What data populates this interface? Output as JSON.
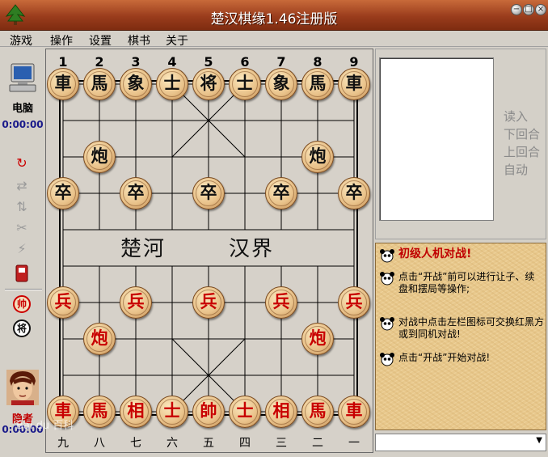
{
  "window": {
    "title": "楚汉棋缘1.46注册版"
  },
  "window_buttons": {
    "minimize": "−",
    "maximize": "□",
    "close": "×"
  },
  "menu": [
    {
      "label": "游戏"
    },
    {
      "label": "操作"
    },
    {
      "label": "设置"
    },
    {
      "label": "棋书"
    },
    {
      "label": "关于"
    }
  ],
  "top_player": {
    "name": "电脑",
    "time": "0:00:00"
  },
  "bottom_player": {
    "name": "隐者",
    "time": "0:00:00"
  },
  "tools": {
    "swap_side": "帅",
    "black_side": "将"
  },
  "board": {
    "col_numbers": [
      "1",
      "2",
      "3",
      "4",
      "5",
      "6",
      "7",
      "8",
      "9"
    ],
    "col_chinese": [
      "九",
      "八",
      "七",
      "六",
      "五",
      "四",
      "三",
      "二",
      "一"
    ],
    "river_left": "楚河",
    "river_right": "汉界",
    "pieces": [
      {
        "ch": "車",
        "side": "black",
        "col": 0,
        "row": 0
      },
      {
        "ch": "馬",
        "side": "black",
        "col": 1,
        "row": 0
      },
      {
        "ch": "象",
        "side": "black",
        "col": 2,
        "row": 0
      },
      {
        "ch": "士",
        "side": "black",
        "col": 3,
        "row": 0
      },
      {
        "ch": "将",
        "side": "black",
        "col": 4,
        "row": 0
      },
      {
        "ch": "士",
        "side": "black",
        "col": 5,
        "row": 0
      },
      {
        "ch": "象",
        "side": "black",
        "col": 6,
        "row": 0
      },
      {
        "ch": "馬",
        "side": "black",
        "col": 7,
        "row": 0
      },
      {
        "ch": "車",
        "side": "black",
        "col": 8,
        "row": 0
      },
      {
        "ch": "炮",
        "side": "black",
        "col": 1,
        "row": 2
      },
      {
        "ch": "炮",
        "side": "black",
        "col": 7,
        "row": 2
      },
      {
        "ch": "卒",
        "side": "black",
        "col": 0,
        "row": 3
      },
      {
        "ch": "卒",
        "side": "black",
        "col": 2,
        "row": 3
      },
      {
        "ch": "卒",
        "side": "black",
        "col": 4,
        "row": 3
      },
      {
        "ch": "卒",
        "side": "black",
        "col": 6,
        "row": 3
      },
      {
        "ch": "卒",
        "side": "black",
        "col": 8,
        "row": 3
      },
      {
        "ch": "兵",
        "side": "red",
        "col": 0,
        "row": 6
      },
      {
        "ch": "兵",
        "side": "red",
        "col": 2,
        "row": 6
      },
      {
        "ch": "兵",
        "side": "red",
        "col": 4,
        "row": 6
      },
      {
        "ch": "兵",
        "side": "red",
        "col": 6,
        "row": 6
      },
      {
        "ch": "兵",
        "side": "red",
        "col": 8,
        "row": 6
      },
      {
        "ch": "炮",
        "side": "red",
        "col": 1,
        "row": 7
      },
      {
        "ch": "炮",
        "side": "red",
        "col": 7,
        "row": 7
      },
      {
        "ch": "車",
        "side": "red",
        "col": 0,
        "row": 9
      },
      {
        "ch": "馬",
        "side": "red",
        "col": 1,
        "row": 9
      },
      {
        "ch": "相",
        "side": "red",
        "col": 2,
        "row": 9
      },
      {
        "ch": "士",
        "side": "red",
        "col": 3,
        "row": 9
      },
      {
        "ch": "帥",
        "side": "red",
        "col": 4,
        "row": 9
      },
      {
        "ch": "士",
        "side": "red",
        "col": 5,
        "row": 9
      },
      {
        "ch": "相",
        "side": "red",
        "col": 6,
        "row": 9
      },
      {
        "ch": "馬",
        "side": "red",
        "col": 7,
        "row": 9
      },
      {
        "ch": "車",
        "side": "red",
        "col": 8,
        "row": 9
      }
    ]
  },
  "controls": {
    "read_in": "读入",
    "next_move": "下回合",
    "prev_move": "上回合",
    "auto": "自动"
  },
  "messages": {
    "headline": "初级人机对战!",
    "m1": "点击“开战”前可以进行让子、续盘和摆局等操作;",
    "m2": "对战中点击左栏图标可交换红黑方或到同机对战!",
    "m3": "点击“开战”开始对战!"
  },
  "watermark": "Bai du 百科",
  "colors": {
    "red_piece": "#c80000",
    "black_piece": "#111111",
    "title_bar": "#9a3c1c"
  }
}
